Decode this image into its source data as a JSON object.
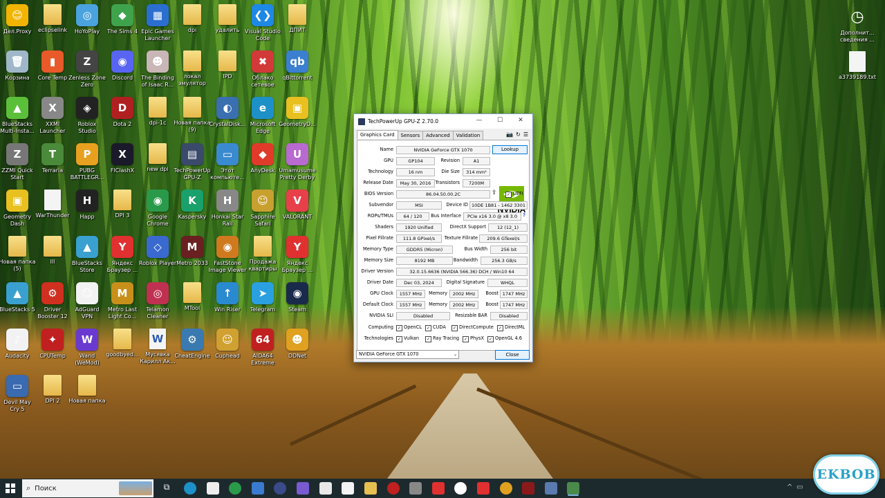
{
  "desktop_icons": [
    {
      "label": "Дел.Proxy",
      "color": "#f1b400",
      "kind": "app",
      "glyph": "😊"
    },
    {
      "label": "eclipselink",
      "color": "#f4d06f",
      "kind": "folder",
      "glyph": ""
    },
    {
      "label": "HoYoPlay",
      "color": "#4aa3df",
      "kind": "app",
      "glyph": "◎"
    },
    {
      "label": "The Sims 4",
      "color": "#3fa34d",
      "kind": "app",
      "glyph": "◆"
    },
    {
      "label": "Epic Games\nLauncher",
      "color": "#2a6fd0",
      "kind": "app",
      "glyph": "▦"
    },
    {
      "label": "dpi",
      "color": "#f4d06f",
      "kind": "folder",
      "glyph": ""
    },
    {
      "label": "удалить",
      "color": "#f4d06f",
      "kind": "folder",
      "glyph": ""
    },
    {
      "label": "Visual Studio\nCode",
      "color": "#1e88e5",
      "kind": "app",
      "glyph": "❮❯"
    },
    {
      "label": "ДПИТ",
      "color": "#f4d06f",
      "kind": "folder",
      "glyph": ""
    },
    {
      "label": "Корзина",
      "color": "#9fb7c9",
      "kind": "app",
      "glyph": "🗑"
    },
    {
      "label": "Core Temp",
      "color": "#e85a2a",
      "kind": "app",
      "glyph": "▮"
    },
    {
      "label": "Zenless Zone\nZero",
      "color": "#444",
      "kind": "app",
      "glyph": "Z"
    },
    {
      "label": "Discord",
      "color": "#5865f2",
      "kind": "app",
      "glyph": "◉"
    },
    {
      "label": "The Binding\nof Isaac R...",
      "color": "#c9b6b6",
      "kind": "app",
      "glyph": "☻"
    },
    {
      "label": "локал\nэмулятор",
      "color": "#5a9a5a",
      "kind": "folder",
      "glyph": ""
    },
    {
      "label": "IPD",
      "color": "#f4d06f",
      "kind": "folder",
      "glyph": ""
    },
    {
      "label": "Облако\nсетевое",
      "color": "#d23a3a",
      "kind": "app",
      "glyph": "✖"
    },
    {
      "label": "qBittorrent",
      "color": "#3a7fd0",
      "kind": "app",
      "glyph": "qb"
    },
    {
      "label": "BlueStacks\nMulti-Insta...",
      "color": "#5bbf3a",
      "kind": "app",
      "glyph": "▲"
    },
    {
      "label": "XXMI\nLauncher",
      "color": "#888",
      "kind": "app",
      "glyph": "X"
    },
    {
      "label": "Roblox\nStudio",
      "color": "#222",
      "kind": "app",
      "glyph": "◈"
    },
    {
      "label": "Dota 2",
      "color": "#b02020",
      "kind": "app",
      "glyph": "D"
    },
    {
      "label": "dpi-1c",
      "color": "#f4d06f",
      "kind": "folder",
      "glyph": ""
    },
    {
      "label": "Новая папка\n(9)",
      "color": "#f4d06f",
      "kind": "folder",
      "glyph": ""
    },
    {
      "label": "CrystalDisk...",
      "color": "#3a6fb0",
      "kind": "app",
      "glyph": "◐"
    },
    {
      "label": "Microsoft\nEdge",
      "color": "#1e90c8",
      "kind": "app",
      "glyph": "e"
    },
    {
      "label": "GeometryD...",
      "color": "#e8c020",
      "kind": "app",
      "glyph": "▣"
    },
    {
      "label": "ZZMI Quick\nStart",
      "color": "#777",
      "kind": "app",
      "glyph": "Z"
    },
    {
      "label": "Terraria",
      "color": "#4a8a3a",
      "kind": "app",
      "glyph": "T"
    },
    {
      "label": "PUBG\nBATTLEGR...",
      "color": "#e8a020",
      "kind": "app",
      "glyph": "P"
    },
    {
      "label": "FlClashX",
      "color": "#1a1a2a",
      "kind": "app",
      "glyph": "X"
    },
    {
      "label": "new dpi",
      "color": "#f4d06f",
      "kind": "folder",
      "glyph": ""
    },
    {
      "label": "TechPowerUp\nGPU-Z",
      "color": "#3a4a6a",
      "kind": "app",
      "glyph": "▤"
    },
    {
      "label": "Этот\nкомпьюте...",
      "color": "#3a8ad0",
      "kind": "app",
      "glyph": "▭"
    },
    {
      "label": "AnyDesk",
      "color": "#e03a2a",
      "kind": "app",
      "glyph": "◆"
    },
    {
      "label": "Umamusume\nPretty Derby",
      "color": "#b86ad0",
      "kind": "app",
      "glyph": "U"
    },
    {
      "label": "Geometry\nDash",
      "color": "#e8c020",
      "kind": "app",
      "glyph": "▣"
    },
    {
      "label": "WarThunder",
      "color": "#f2f2f2",
      "kind": "file",
      "glyph": ""
    },
    {
      "label": "Happ",
      "color": "#222",
      "kind": "app",
      "glyph": "H"
    },
    {
      "label": "DPI 3",
      "color": "#f4d06f",
      "kind": "folder",
      "glyph": ""
    },
    {
      "label": "Google\nChrome",
      "color": "#2a9a4a",
      "kind": "app",
      "glyph": "◉"
    },
    {
      "label": "Kaspersky",
      "color": "#1aa06a",
      "kind": "app",
      "glyph": "K"
    },
    {
      "label": "Honkai Star\nRail",
      "color": "#888",
      "kind": "app",
      "glyph": "H"
    },
    {
      "label": "Sapphire\nSafari",
      "color": "#c8a030",
      "kind": "app",
      "glyph": "☺"
    },
    {
      "label": "VALORANT",
      "color": "#e8404a",
      "kind": "app",
      "glyph": "V"
    },
    {
      "label": "Новая папка\n(5)",
      "color": "#f4d06f",
      "kind": "folder",
      "glyph": ""
    },
    {
      "label": "lll",
      "color": "#f4d06f",
      "kind": "folder",
      "glyph": ""
    },
    {
      "label": "BlueStacks\nStore",
      "color": "#3aa0d0",
      "kind": "app",
      "glyph": "▲"
    },
    {
      "label": "Яндекс\nБраузер ...",
      "color": "#e03030",
      "kind": "app",
      "glyph": "Y"
    },
    {
      "label": "Roblox Player",
      "color": "#3a6ad0",
      "kind": "app",
      "glyph": "◇"
    },
    {
      "label": "Metro 2033",
      "color": "#6a2020",
      "kind": "app",
      "glyph": "M"
    },
    {
      "label": "FastStone\nImage Viewer",
      "color": "#d07a20",
      "kind": "app",
      "glyph": "◉"
    },
    {
      "label": "Продажа\nквартиры",
      "color": "#f4d06f",
      "kind": "folder",
      "glyph": ""
    },
    {
      "label": "Яндекс\nБраузер ...",
      "color": "#e03030",
      "kind": "app",
      "glyph": "Y"
    },
    {
      "label": "BlueStacks 5",
      "color": "#3aa0d0",
      "kind": "app",
      "glyph": "▲"
    },
    {
      "label": "Driver\nBooster 12",
      "color": "#d03020",
      "kind": "app",
      "glyph": "⚙"
    },
    {
      "label": "AdGuard\nVPN",
      "color": "#f2f2f2",
      "kind": "app",
      "glyph": "☺"
    },
    {
      "label": "Metro Last\nLight Co...",
      "color": "#c8901a",
      "kind": "app",
      "glyph": "M"
    },
    {
      "label": "Telamon\nCleaner",
      "color": "#c03050",
      "kind": "app",
      "glyph": "◎"
    },
    {
      "label": "MTool",
      "color": "#f4d06f",
      "kind": "folder",
      "glyph": ""
    },
    {
      "label": "Win Riser",
      "color": "#2a8ad0",
      "kind": "app",
      "glyph": "↑"
    },
    {
      "label": "Telegram",
      "color": "#2aa0e0",
      "kind": "app",
      "glyph": "➤"
    },
    {
      "label": "Steam",
      "color": "#1a2a4a",
      "kind": "app",
      "glyph": "◉"
    },
    {
      "label": "Audacity",
      "color": "#f2f2f2",
      "kind": "app",
      "glyph": "♪"
    },
    {
      "label": "CPUTemp",
      "color": "#c02020",
      "kind": "app",
      "glyph": "✦"
    },
    {
      "label": "Wand\n(WeMod)",
      "color": "#6a3ad0",
      "kind": "app",
      "glyph": "W"
    },
    {
      "label": "goodbyed...",
      "color": "#f4d06f",
      "kind": "folder",
      "glyph": ""
    },
    {
      "label": "Мусявка\nКарилл Ак...",
      "color": "#2a5ab0",
      "kind": "file",
      "glyph": "W"
    },
    {
      "label": "CheatEngine",
      "color": "#3a7ab0",
      "kind": "app",
      "glyph": "⚙"
    },
    {
      "label": "Cuphead",
      "color": "#d0a030",
      "kind": "app",
      "glyph": "☺"
    },
    {
      "label": "AIDA64\nExtreme",
      "color": "#c02020",
      "kind": "app",
      "glyph": "64"
    },
    {
      "label": "DDNet",
      "color": "#e0a020",
      "kind": "app",
      "glyph": "☻"
    },
    {
      "label": "Devil May\nCry 5",
      "color": "#3a6ab0",
      "kind": "app",
      "glyph": "▭"
    },
    {
      "label": "DPI 2",
      "color": "#f4d06f",
      "kind": "folder",
      "glyph": ""
    },
    {
      "label": "Новая папка",
      "color": "#f4d06f",
      "kind": "folder",
      "glyph": ""
    }
  ],
  "right_icons": [
    {
      "label": "Дополнит...\nсведения ...",
      "glyph": "◷"
    },
    {
      "label": "a3739189.txt",
      "glyph": ""
    }
  ],
  "gpuz": {
    "title": "TechPowerUp GPU-Z 2.70.0",
    "tabs": [
      "Graphics Card",
      "Sensors",
      "Advanced",
      "Validation"
    ],
    "lookup_button": "Lookup",
    "logo_text": "NVIDIA",
    "fields": {
      "name_label": "Name",
      "name": "NVIDIA GeForce GTX 1070",
      "gpu_label": "GPU",
      "gpu": "GP104",
      "revision_label": "Revision",
      "revision": "A1",
      "technology_label": "Technology",
      "technology": "16 nm",
      "die_size_label": "Die Size",
      "die_size": "314 mm²",
      "release_date_label": "Release Date",
      "release_date": "May 30, 2016",
      "transistors_label": "Transistors",
      "transistors": "7200M",
      "bios_label": "BIOS Version",
      "bios": "86.04.50.00.2C",
      "uefi_label": "UEFI",
      "subvendor_label": "Subvendor",
      "subvendor": "MSI",
      "device_id_label": "Device ID",
      "device_id": "10DE 1B81 - 1462 3301",
      "rops_label": "ROPs/TMUs",
      "rops": "64 / 120",
      "bus_label": "Bus Interface",
      "bus": "PCIe x16 3.0 @ x8 3.0",
      "shaders_label": "Shaders",
      "shaders": "1920 Unified",
      "directx_label": "DirectX Support",
      "directx": "12 (12_1)",
      "pixel_label": "Pixel Fillrate",
      "pixel": "111.8 GPixel/s",
      "texture_label": "Texture Fillrate",
      "texture": "209.6 GTexel/s",
      "memtype_label": "Memory Type",
      "memtype": "GDDR5 (Micron)",
      "buswidth_label": "Bus Width",
      "buswidth": "256 bit",
      "memsize_label": "Memory Size",
      "memsize": "8192 MB",
      "bandwidth_label": "Bandwidth",
      "bandwidth": "256.3 GB/s",
      "driver_label": "Driver Version",
      "driver": "32.0.15.6636 (NVIDIA 566.36) DCH / Win10 64",
      "driver_date_label": "Driver Date",
      "driver_date": "Dec 03, 2024",
      "signature_label": "Digital Signature",
      "signature": "WHQL",
      "gpu_clock_label": "GPU Clock",
      "gpu_clock": "1557 MHz",
      "memory_label": "Memory",
      "mem_clock": "2002 MHz",
      "boost_label": "Boost",
      "boost": "1747 MHz",
      "default_clock_label": "Default Clock",
      "default_clock": "1557 MHz",
      "default_mem": "2002 MHz",
      "default_boost": "1747 MHz",
      "sli_label": "NVIDIA SLI",
      "sli": "Disabled",
      "rebar_label": "Resizable BAR",
      "rebar": "Disabled",
      "computing_label": "Computing",
      "technologies_label": "Technologies"
    },
    "computing": [
      "OpenCL",
      "CUDA",
      "DirectCompute",
      "DirectML"
    ],
    "technologies": [
      "Vulkan",
      "Ray Tracing",
      "PhysX",
      "OpenGL 4.6"
    ],
    "selected_gpu": "NVIDIA GeForce GTX 1070",
    "close_button": "Close"
  },
  "taskbar": {
    "search_placeholder": "Поиск"
  },
  "watermark": "EKBOB"
}
